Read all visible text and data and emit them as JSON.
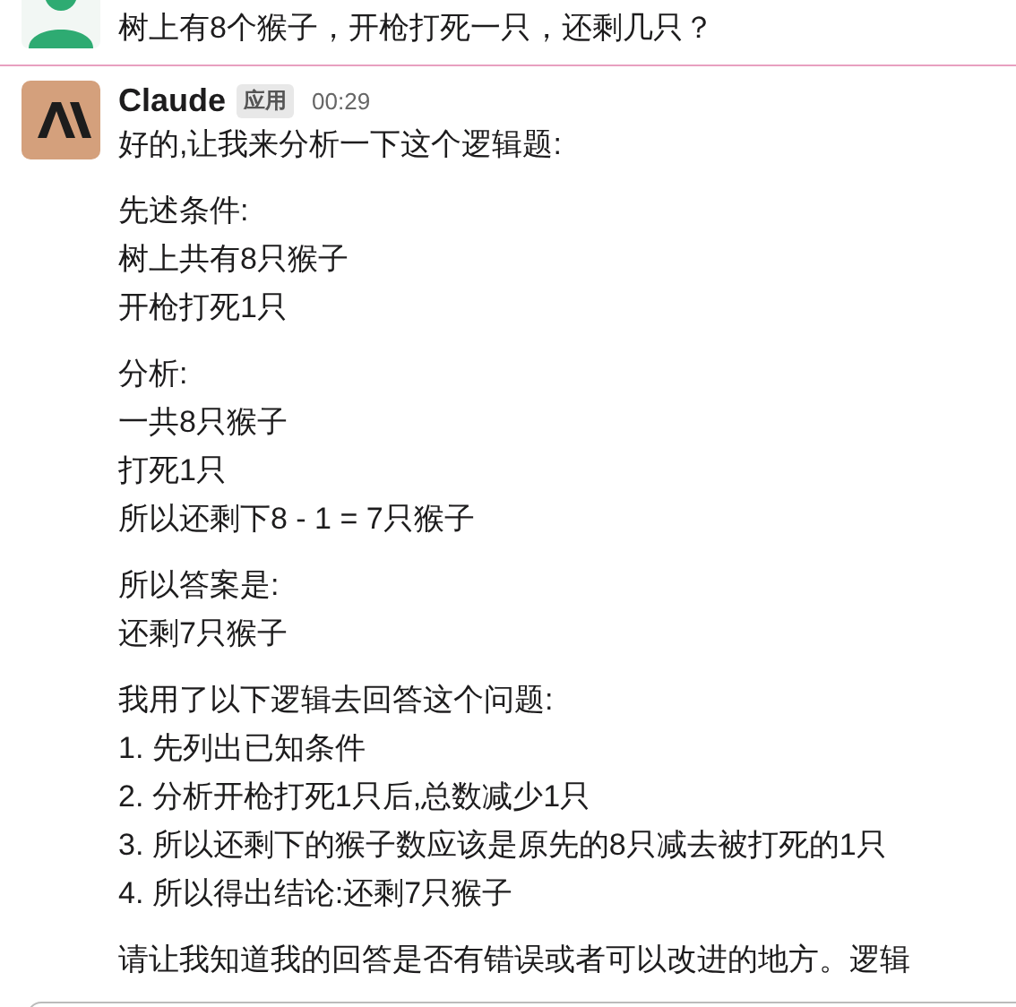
{
  "previous_message": {
    "text": "树上有8个猴子，开枪打死一只，还剩几只？"
  },
  "message": {
    "author": "Claude",
    "badge": "应用",
    "time": "00:29",
    "paragraphs": [
      [
        "好的,让我来分析一下这个逻辑题:"
      ],
      [
        "先述条件:",
        "树上共有8只猴子",
        "开枪打死1只"
      ],
      [
        "分析:",
        "一共8只猴子",
        "打死1只",
        "所以还剩下8 - 1 = 7只猴子"
      ],
      [
        "所以答案是:",
        "还剩7只猴子"
      ],
      [
        "我用了以下逻辑去回答这个问题:",
        "1. 先列出已知条件",
        "2. 分析开枪打死1只后,总数减少1只",
        "3. 所以还剩下的猴子数应该是原先的8只减去被打死的1只",
        "4. 所以得出结论:还剩7只猴子"
      ],
      [
        "请让我知道我的回答是否有错误或者可以改进的地方。逻辑"
      ]
    ]
  }
}
